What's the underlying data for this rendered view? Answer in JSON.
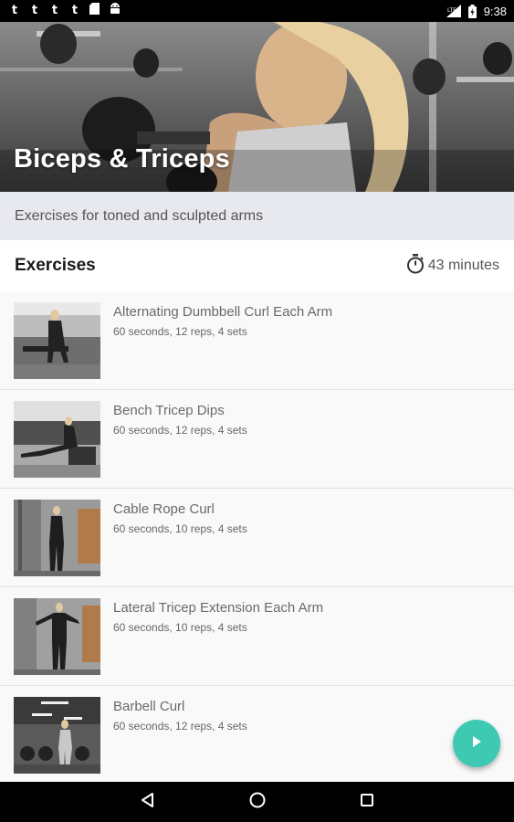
{
  "status_bar": {
    "left_icons": [
      "t-notification-icon",
      "t-notification-icon",
      "t-notification-icon",
      "t-notification-icon",
      "sd-card-icon",
      "android-icon"
    ],
    "left_glyphs": [
      "t",
      "t",
      "t",
      "t",
      "",
      ""
    ],
    "network_label": "LTE",
    "time": "9:38"
  },
  "hero": {
    "title": "Biceps & Triceps"
  },
  "description": "Exercises for toned and sculpted arms",
  "exercises_section": {
    "title": "Exercises",
    "duration": "43 minutes"
  },
  "exercises": [
    {
      "name": "Alternating Dumbbell Curl Each Arm",
      "detail": "60 seconds, 12 reps, 4 sets"
    },
    {
      "name": "Bench Tricep Dips",
      "detail": "60 seconds, 12 reps, 4 sets"
    },
    {
      "name": "Cable Rope Curl",
      "detail": "60 seconds, 10 reps, 4 sets"
    },
    {
      "name": "Lateral Tricep Extension Each Arm",
      "detail": "60 seconds, 10 reps, 4 sets"
    },
    {
      "name": "Barbell Curl",
      "detail": "60 seconds, 12 reps, 4 sets"
    }
  ],
  "fab": {
    "icon": "play-icon",
    "color": "#3ec9b3"
  },
  "nav_bar": {
    "icons": [
      "back-icon",
      "home-icon",
      "recents-icon"
    ]
  }
}
